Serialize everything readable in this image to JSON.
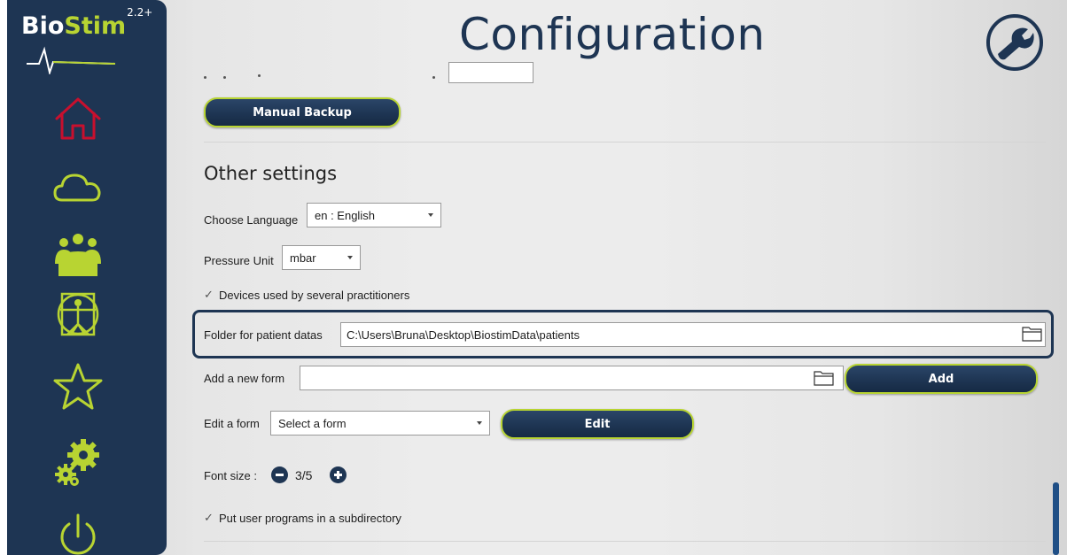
{
  "app": {
    "logo_text_1": "Bio",
    "logo_text_2": "Stim",
    "version": "2.2+",
    "page_title": "Configuration"
  },
  "sidebar": {
    "items": [
      {
        "name": "home",
        "icon": "home-icon"
      },
      {
        "name": "cloud",
        "icon": "cloud-icon"
      },
      {
        "name": "patients",
        "icon": "users-icon"
      },
      {
        "name": "anatomy",
        "icon": "vitruvian-man-icon"
      },
      {
        "name": "favorites",
        "icon": "star-icon"
      },
      {
        "name": "settings",
        "icon": "gears-icon"
      },
      {
        "name": "power",
        "icon": "power-icon"
      }
    ]
  },
  "backup": {
    "manual_backup_label": "Manual Backup"
  },
  "other_settings": {
    "title": "Other settings",
    "language_label": "Choose Language",
    "language_value": "en : English",
    "pressure_label": "Pressure Unit",
    "pressure_value": "mbar",
    "several_practitioners_label": "Devices used by several practitioners",
    "several_practitioners_checked": true,
    "patient_folder_label": "Folder for patient datas",
    "patient_folder_value": "C:\\Users\\Bruna\\Desktop\\BiostimData\\patients",
    "new_form_label": "Add a new form",
    "new_form_value": "",
    "add_button_label": "Add",
    "edit_form_label": "Edit a form",
    "edit_form_value": "Select a form",
    "edit_button_label": "Edit",
    "font_size_label": "Font size :",
    "font_size_value": "3/5",
    "subdirectory_label": "Put user programs in a subdirectory",
    "subdirectory_checked": true,
    "check_glyph": "✓"
  },
  "colors": {
    "sidebar": "#1e3553",
    "accent": "#b8d432",
    "home_icon": "#c8102e",
    "scrollbar": "#1f4f86"
  }
}
